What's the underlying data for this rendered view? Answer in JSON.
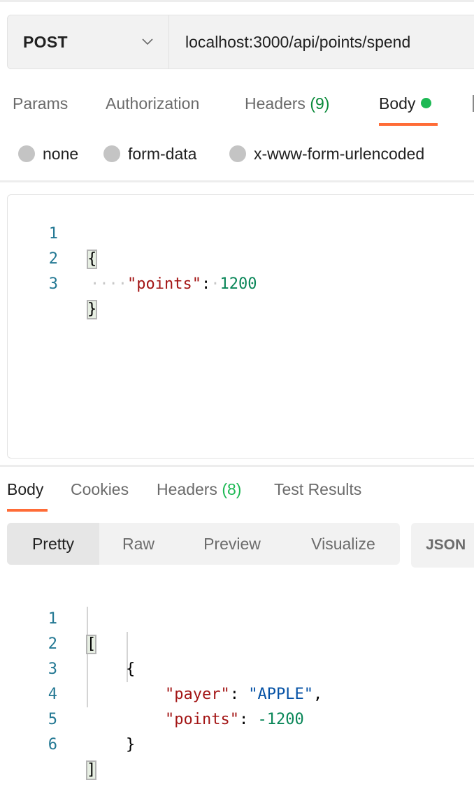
{
  "request": {
    "method": "POST",
    "method_dropdown_icon": "chevron-down-icon",
    "url": "localhost:3000/api/points/spend",
    "tabs": [
      {
        "label": "Params"
      },
      {
        "label": "Authorization"
      },
      {
        "label": "Headers",
        "count": "(9)"
      },
      {
        "label": "Body",
        "active": true,
        "indicator": "green-dot"
      }
    ],
    "body_types": [
      {
        "label": "none"
      },
      {
        "label": "form-data"
      },
      {
        "label": "x-www-form-urlencoded"
      }
    ],
    "body_editor": {
      "lines": [
        {
          "n": "1",
          "text": "{"
        },
        {
          "n": "2",
          "key": "\"points\"",
          "colon": ":",
          "value": "1200",
          "indent": "····"
        },
        {
          "n": "3",
          "text": "}"
        }
      ]
    }
  },
  "response": {
    "tabs": [
      {
        "label": "Body",
        "active": true
      },
      {
        "label": "Cookies"
      },
      {
        "label": "Headers",
        "count": "(8)"
      },
      {
        "label": "Test Results"
      }
    ],
    "view_modes": [
      {
        "label": "Pretty",
        "active": true
      },
      {
        "label": "Raw"
      },
      {
        "label": "Preview"
      },
      {
        "label": "Visualize"
      }
    ],
    "format": "JSON",
    "body": {
      "lines": [
        {
          "n": "1",
          "text": "["
        },
        {
          "n": "2",
          "text": "{"
        },
        {
          "n": "3",
          "key": "\"payer\"",
          "colon": ":",
          "value": "\"APPLE\"",
          "trail": ","
        },
        {
          "n": "4",
          "key": "\"points\"",
          "colon": ":",
          "value": "-1200"
        },
        {
          "n": "5",
          "text": "}"
        },
        {
          "n": "6",
          "text": "]"
        }
      ]
    }
  },
  "colors": {
    "accent": "#ff6c37",
    "status_green": "#1db954",
    "json_key": "#a31515",
    "json_number": "#098658",
    "json_string": "#0451a5",
    "line_number": "#237893"
  }
}
